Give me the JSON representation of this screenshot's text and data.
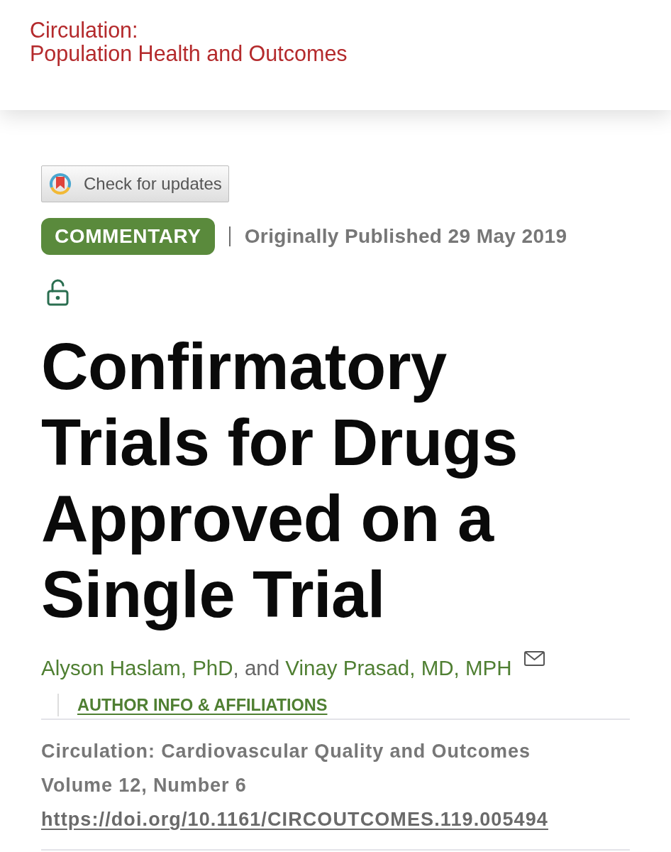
{
  "header": {
    "journal_lines": [
      "Circulation:",
      "Population Health and Outcomes"
    ]
  },
  "update_button": {
    "label": "Check for updates"
  },
  "article_type": "COMMENTARY",
  "published": "Originally Published 29 May 2019",
  "open_access": true,
  "title": "Confirmatory Trials for Drugs Approved on a Single Trial",
  "authors": [
    {
      "name": "Alyson Haslam, PhD"
    },
    {
      "name": "Vinay Prasad, MD, MPH"
    }
  ],
  "author_separator": ", and",
  "author_info_link": "AUTHOR INFO & AFFILIATIONS",
  "citation": {
    "journal": "Circulation: Cardiovascular Quality and Outcomes",
    "issue": "Volume 12, Number 6",
    "doi": "https://doi.org/10.1161/CIRCOUTCOMES.119.005494"
  }
}
